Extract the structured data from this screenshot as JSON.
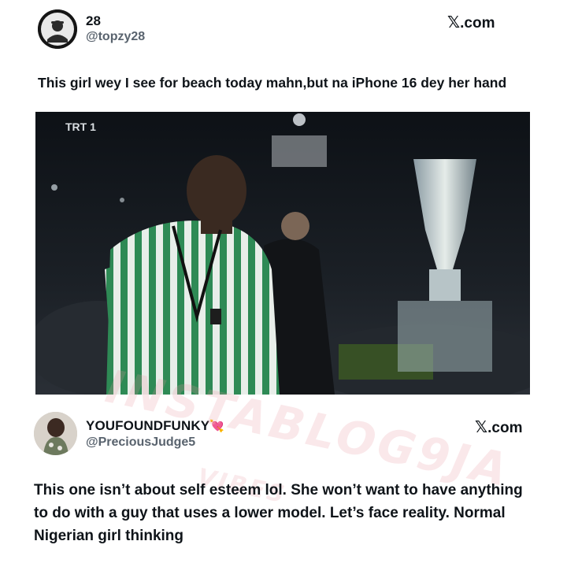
{
  "tweet1": {
    "display_name": "28",
    "handle": "@topzy28",
    "source_glyph": "𝕏",
    "source_label": ".com",
    "text": "This girl wey I see for beach today mahn,but na iPhone 16 dey her hand",
    "media": {
      "broadcaster_logo": "TRT 1",
      "description_icon": "video-still"
    }
  },
  "tweet2": {
    "display_name": "YOUFOUNDFUNKY",
    "name_emoji": "💘",
    "handle": "@PreciousJudge5",
    "source_glyph": "𝕏",
    "source_label": ".com",
    "text": "This one isn’t about self esteem lol. She won’t want to have anything to do with a guy that uses a lower model. Let’s face reality. Normal Nigerian girl thinking"
  },
  "watermark": {
    "main": "INSTABLOG9JA",
    "sub": "VIBES"
  },
  "colors": {
    "text": "#0f1419",
    "handle": "#59636e",
    "background": "#ffffff"
  }
}
